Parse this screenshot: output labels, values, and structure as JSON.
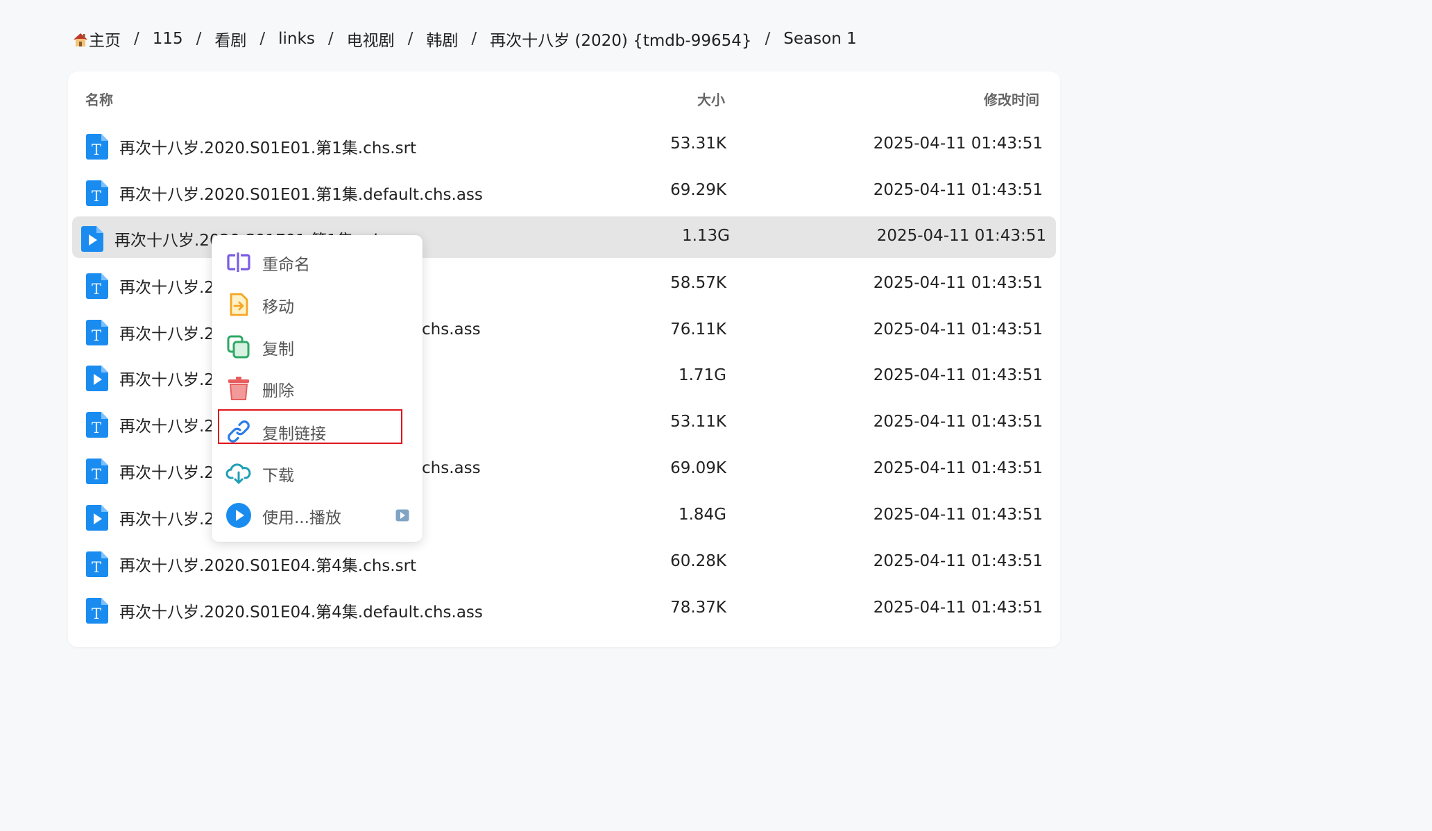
{
  "breadcrumb": [
    "主页",
    "115",
    "看剧",
    "links",
    "电视剧",
    "韩剧",
    "再次十八岁 (2020) {tmdb-99654}",
    "Season 1"
  ],
  "table": {
    "columns": {
      "name": "名称",
      "size": "大小",
      "modified": "修改时间"
    },
    "rows": [
      {
        "type": "text",
        "name": "再次十八岁.2020.S01E01.第1集.chs.srt",
        "size": "53.31K",
        "modified": "2025-04-11 01:43:51"
      },
      {
        "type": "text",
        "name": "再次十八岁.2020.S01E01.第1集.default.chs.ass",
        "size": "69.29K",
        "modified": "2025-04-11 01:43:51"
      },
      {
        "type": "video",
        "name": "再次十八岁.2020.S01E01.第1集.mkv",
        "size": "1.13G",
        "modified": "2025-04-11 01:43:51",
        "selected": true
      },
      {
        "type": "text",
        "name": "再次十八岁.2",
        "size": "58.57K",
        "modified": "2025-04-11 01:43:51"
      },
      {
        "type": "text",
        "name": "再次十八岁.2",
        "name_tail": "chs.ass",
        "size": "76.11K",
        "modified": "2025-04-11 01:43:51"
      },
      {
        "type": "video",
        "name": "再次十八岁.2",
        "size": "1.71G",
        "modified": "2025-04-11 01:43:51"
      },
      {
        "type": "text",
        "name": "再次十八岁.2",
        "size": "53.11K",
        "modified": "2025-04-11 01:43:51"
      },
      {
        "type": "text",
        "name": "再次十八岁.2",
        "name_tail": "chs.ass",
        "size": "69.09K",
        "modified": "2025-04-11 01:43:51"
      },
      {
        "type": "video",
        "name": "再次十八岁.2",
        "size": "1.84G",
        "modified": "2025-04-11 01:43:51"
      },
      {
        "type": "text",
        "name": "再次十八岁.2020.S01E04.第4集.chs.srt",
        "size": "60.28K",
        "modified": "2025-04-11 01:43:51"
      },
      {
        "type": "text",
        "name": "再次十八岁.2020.S01E04.第4集.default.chs.ass",
        "size": "78.37K",
        "modified": "2025-04-11 01:43:51"
      }
    ]
  },
  "context_menu": {
    "items": [
      {
        "label": "重命名",
        "icon": "rename-icon",
        "color": "#7b5ce6"
      },
      {
        "label": "移动",
        "icon": "move-icon",
        "color": "#f5a623"
      },
      {
        "label": "复制",
        "icon": "copy-icon",
        "color": "#2fa865"
      },
      {
        "label": "删除",
        "icon": "delete-icon",
        "color": "#e85d5d"
      },
      {
        "label": "复制链接",
        "icon": "link-icon",
        "color": "#2b7de9",
        "highlighted": true
      },
      {
        "label": "下载",
        "icon": "download-cloud-icon",
        "color": "#1f9fb5"
      },
      {
        "label": "使用...播放",
        "icon": "play-circle-icon",
        "color": "#1a8cf0",
        "has_submenu": true
      }
    ]
  },
  "colors": {
    "file_icon_blue": "#1a8cf0",
    "selected_row": "#e5e5e5",
    "highlight_border": "#e0141d"
  }
}
